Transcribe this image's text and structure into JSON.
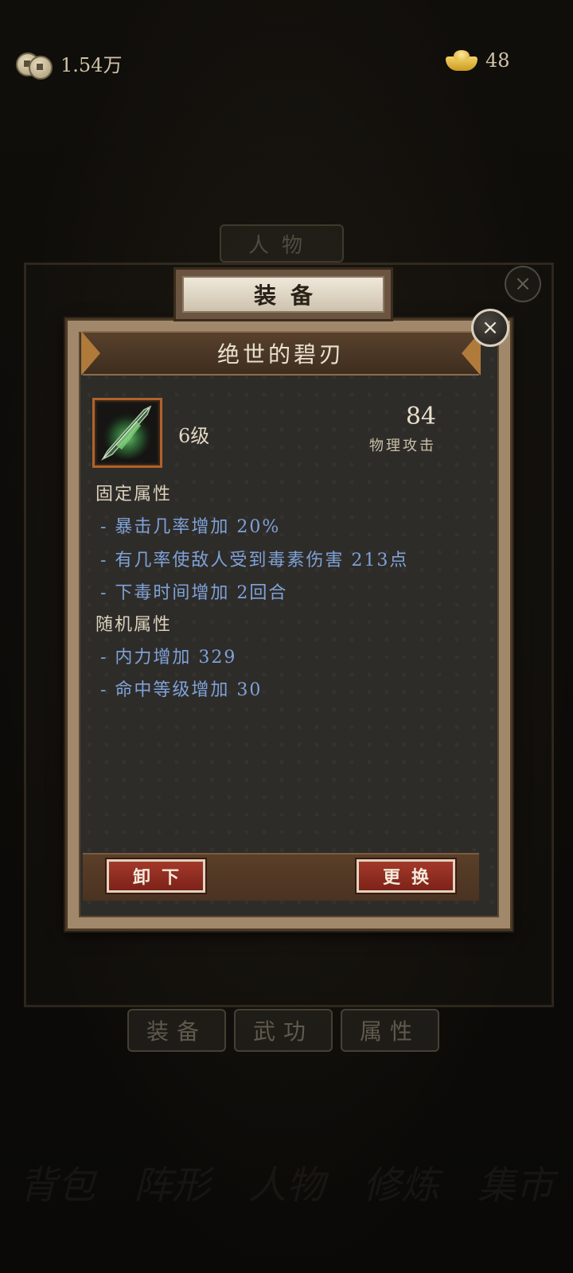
{
  "currency": {
    "coins": "1.54万",
    "ingots": "48"
  },
  "background": {
    "character_tab": "人物",
    "bottom_tabs": [
      "装备",
      "武功",
      "属性"
    ],
    "nav": [
      "背包",
      "阵形",
      "人物",
      "修炼",
      "集市"
    ]
  },
  "dialog": {
    "header": "装备",
    "close_icon": "×",
    "item_name": "绝世的碧刃",
    "level": "6级",
    "stat_value": "84",
    "stat_label": "物理攻击",
    "fixed_heading": "固定属性",
    "fixed_attrs": [
      "- 暴击几率增加 20%",
      "- 有几率使敌人受到毒素伤害 213点",
      "- 下毒时间增加 2回合"
    ],
    "random_heading": "随机属性",
    "random_attrs": [
      "- 内力增加 329",
      "- 命中等级增加 30"
    ],
    "unequip_label": "卸下",
    "replace_label": "更换"
  },
  "colors": {
    "attr_blue": "#7fa2d8",
    "button_red": "#a3392b",
    "frame_gold": "#a1886a"
  }
}
